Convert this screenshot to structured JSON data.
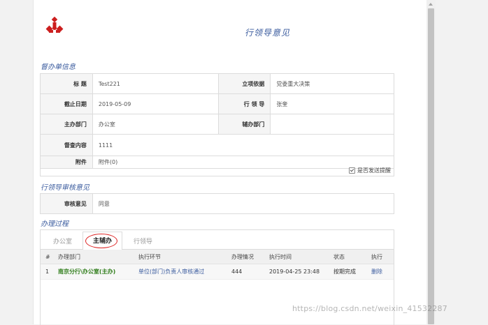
{
  "page": {
    "title": "行领导意见"
  },
  "sections": {
    "info": "督办单信息",
    "review": "行领导审核意见",
    "process": "办理过程"
  },
  "form": {
    "title_label": "标  题",
    "title_value": "Test221",
    "basis_label": "立项依据",
    "basis_value": "党委重大决策",
    "deadline_label": "截止日期",
    "deadline_value": "2019-05-09",
    "leader_label": "行 领 导",
    "leader_value": "张奎",
    "lead_dept_label": "主办部门",
    "lead_dept_value": "办公室",
    "assist_dept_label": "辅办部门",
    "assist_dept_value": "",
    "content_label": "督查内容",
    "content_value": "1111",
    "attach_label": "附件",
    "attach_value": "附件(0)",
    "remind_label": "是否发送提醒",
    "remind_checked": true
  },
  "review": {
    "label": "审核意见",
    "value": "同意"
  },
  "tabs": [
    {
      "label": "办公室",
      "active": false
    },
    {
      "label": "主辅办",
      "active": true
    },
    {
      "label": "行领导",
      "active": false
    }
  ],
  "grid": {
    "headers": [
      "#",
      "办理部门",
      "执行环节",
      "办理情况",
      "执行时间",
      "状态",
      "执行"
    ],
    "rows": [
      {
        "no": "1",
        "dept": "南京分行\\办公室(主办)",
        "step": "单位(部门)负责人审核通过",
        "status_text": "444",
        "time": "2019-04-25 23:48",
        "state": "按期完成",
        "action": "删除"
      }
    ]
  },
  "watermark": "https://blog.csdn.net/weixin_41532287",
  "colors": {
    "accent": "#3a5b9e",
    "logo": "#cc1f1f",
    "dept_green": "#2f7d1a"
  }
}
